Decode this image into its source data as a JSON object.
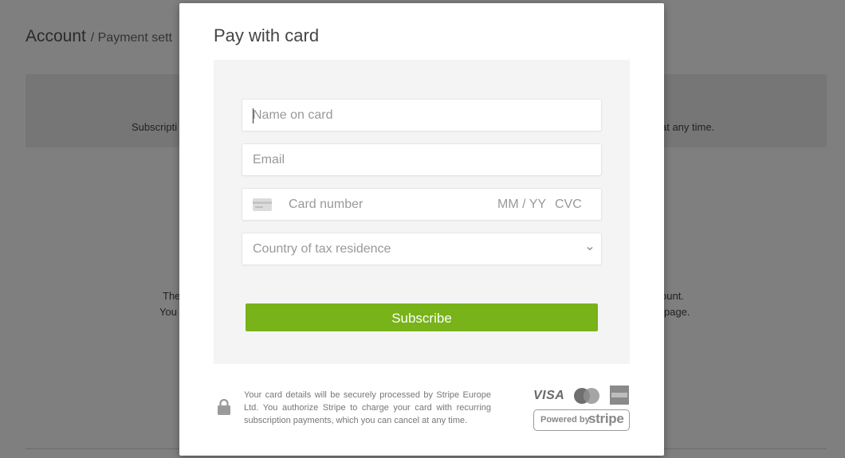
{
  "background": {
    "title": "Account",
    "title_sub": "/ Payment sett",
    "banner_left": "Subscripti",
    "banner_right": "at any time.",
    "text_left_1": "The",
    "text_left_2": "You",
    "text_right_1": "ount.",
    "text_right_2": "page."
  },
  "modal": {
    "title": "Pay with card",
    "fields": {
      "name": {
        "placeholder": "Name on card",
        "value": ""
      },
      "email": {
        "placeholder": "Email",
        "value": ""
      },
      "card_number": {
        "placeholder": "Card number"
      },
      "expiry": {
        "placeholder": "MM / YY"
      },
      "cvc": {
        "placeholder": "CVC"
      },
      "country": {
        "placeholder": "Country of tax residence"
      }
    },
    "subscribe_label": "Subscribe",
    "disclaimer": "Your card details will be securely processed by Stripe Europe Ltd. You authorize Stripe to charge your card with recurring subscription payments, which you can cancel at any time.",
    "card_brands": [
      "VISA",
      "MasterCard",
      "American Express"
    ],
    "powered_by": "Powered by",
    "stripe": "stripe"
  },
  "colors": {
    "accent": "#77b319",
    "overlay": "rgba(0,0,0,0.5)"
  },
  "icons": [
    "credit-card-icon",
    "chevron-down-icon",
    "lock-icon",
    "visa-logo",
    "mastercard-logo",
    "amex-logo"
  ]
}
